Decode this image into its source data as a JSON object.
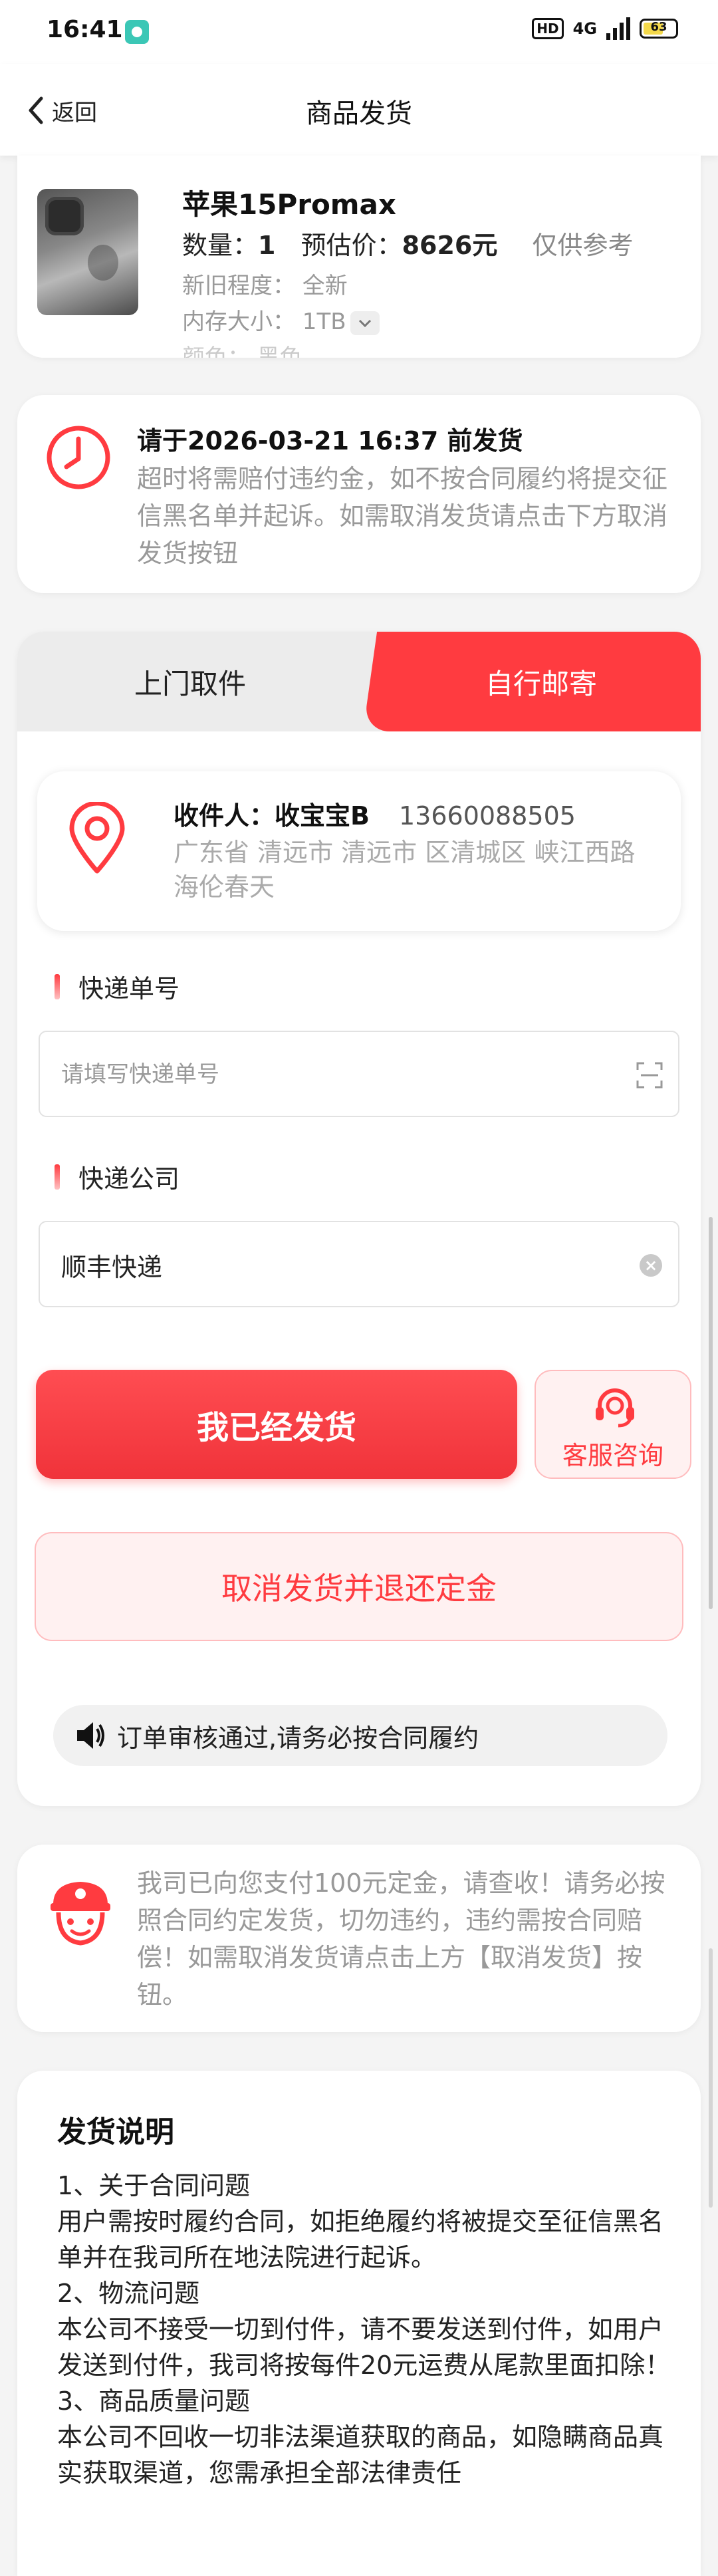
{
  "status_bar": {
    "time": "16:41",
    "hd": "HD",
    "network": "4G",
    "battery": "63",
    "battery_level": 0.63
  },
  "nav": {
    "back_label": "返回",
    "title": "商品发货"
  },
  "product": {
    "name": "苹果15Promax",
    "qty_label": "数量：",
    "qty": "1",
    "price_label": "预估价：",
    "price": "8626元",
    "price_note": "仅供参考",
    "condition": "新旧程度：  全新",
    "storage": "内存大小：  1TB",
    "color": "颜色：  黑色"
  },
  "deadline": {
    "title": "请于2026-03-21 16:37 前发货",
    "desc": "超时将需赔付违约金，如不按合同履约将提交征信黑名单并起诉。如需取消发货请点击下方取消发货按钮"
  },
  "shipping": {
    "tabs": [
      "上门取件",
      "自行邮寄"
    ],
    "active_tab": "自行邮寄",
    "receiver_label": "收件人：",
    "receiver_name": "收宝宝B",
    "receiver_phone": "13660088505",
    "receiver_address": "广东省 清远市 清远市 区清城区 峡江西路海伦春天",
    "tracking_label": "快递单号",
    "tracking_placeholder": "请填写快递单号",
    "tracking_value": "",
    "company_label": "快递公司",
    "company_value": "顺丰快递",
    "ship_button": "我已经发货",
    "service_button": "客服咨询",
    "cancel_button": "取消发货并退还定金",
    "notice": "订单审核通过,请务必按合同履约"
  },
  "deposit": {
    "text": "我司已向您支付100元定金，请查收！请务必按照合同约定发货，切勿违约，违约需按合同赔偿！如需取消发货请点击上方【取消发货】按钮。"
  },
  "instructions": {
    "title": "发货说明",
    "items": [
      {
        "heading": "1、关于合同问题",
        "body": "用户需按时履约合同，如拒绝履约将被提交至征信黑名单并在我司所在地法院进行起诉。"
      },
      {
        "heading": "2、物流问题",
        "body": "本公司不接受一切到付件，请不要发送到付件，如用户发送到付件，我司将按每件20元运费从尾款里面扣除！"
      },
      {
        "heading": "3、商品质量问题",
        "body": "本公司不回收一切非法渠道获取的商品，如隐瞒商品真实获取渠道，您需承担全部法律责任"
      }
    ]
  },
  "colors": {
    "accent": "#ff3b40",
    "accent_light": "#fff1f1",
    "muted_text": "#999999",
    "background": "#f4f4f4"
  }
}
